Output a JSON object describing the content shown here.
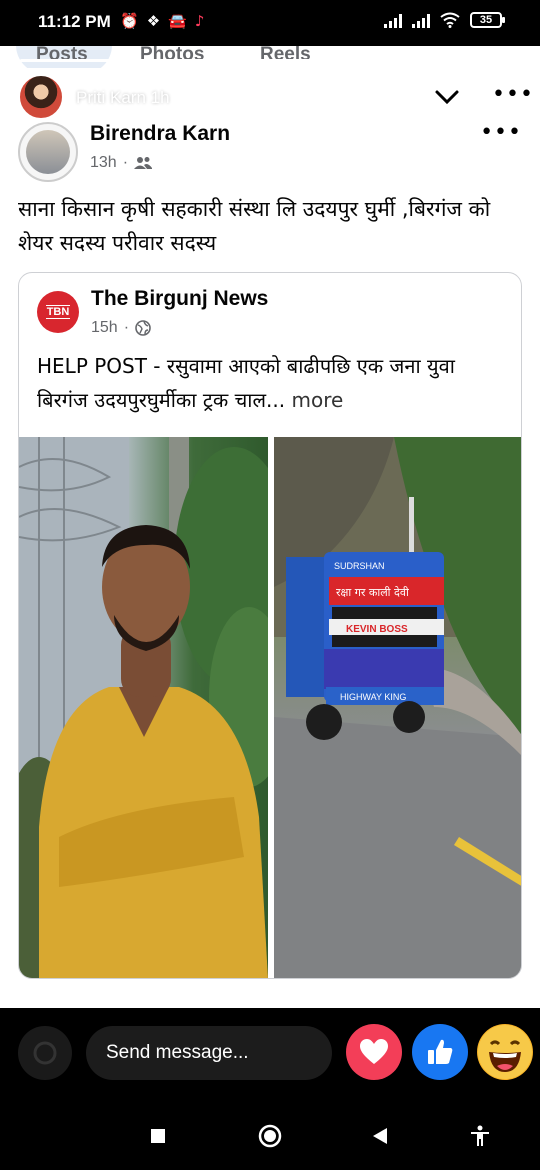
{
  "status_bar": {
    "time": "11:12 PM",
    "left_icons": [
      "alarm-off-icon",
      "dropbox-icon",
      "car-icon",
      "tiktok-icon"
    ],
    "battery": "35"
  },
  "tabs": [
    {
      "label": "Posts"
    },
    {
      "label": "Photos"
    },
    {
      "label": "Reels"
    }
  ],
  "story": {
    "name": "Priti Karn",
    "age": "1h"
  },
  "post": {
    "author": "Birendra Karn",
    "time": "13h",
    "text": "साना किसान कृषी सहकारी संस्था लि उदयपुर घुर्मी ,बिरगंज को शेयर सदस्य परीवार सदस्य"
  },
  "shared_post": {
    "logo_text": "TBN",
    "page_name": "The Birgunj News",
    "time": "15h",
    "text": "HELP POST - रसुवामा आएको बाढीपछि एक जना युवा बिरगंज उदयपुरघुर्मीका ट्रक चाल...",
    "more_label": "more",
    "truck_banner": "रक्षा गर काली देवी",
    "truck_name": "KEVIN BOSS",
    "truck_company": "SUDRSHAN",
    "truck_tag": "HIGHWAY KING"
  },
  "message_bar": {
    "placeholder": "Send message..."
  },
  "colors": {
    "accent": "#1877f2",
    "love": "#f33e58",
    "haha": "#f7b125"
  }
}
